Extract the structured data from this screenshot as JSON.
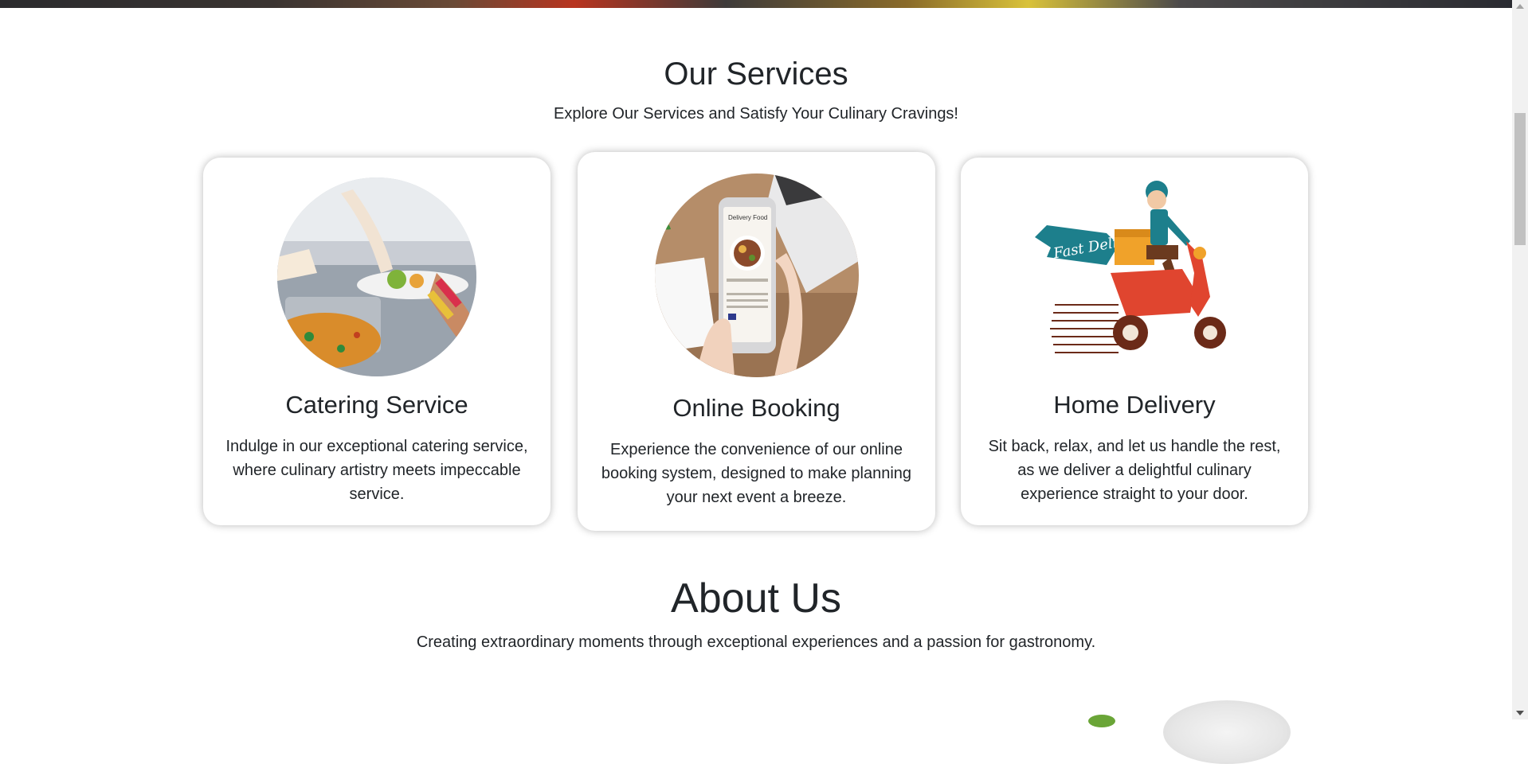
{
  "services": {
    "title": "Our Services",
    "subtitle": "Explore Our Services and Satisfy Your Culinary Cravings!",
    "cards": [
      {
        "title": "Catering Service",
        "text": "Indulge in our exceptional catering service, where culinary artistry meets impeccable service.",
        "image_icon": "catering-photo"
      },
      {
        "title": "Online Booking",
        "text": "Experience the convenience of our online booking system, designed to make planning your next event a breeze.",
        "image_icon": "phone-booking-photo"
      },
      {
        "title": "Home Delivery",
        "text": "Sit back, relax, and let us handle the rest, as we deliver a delightful culinary experience straight to your door.",
        "image_icon": "fast-delivery-scooter-illustration",
        "banner_text": "Fast Delivery"
      }
    ]
  },
  "about": {
    "title": "About Us",
    "subtitle": "Creating extraordinary moments through exceptional experiences and a passion for gastronomy."
  },
  "phone_screen": {
    "header": "Delivery Food"
  },
  "colors": {
    "text": "#212529",
    "card_bg": "#ffffff",
    "scooter_red": "#e0452f",
    "banner_teal": "#1d7f8c"
  }
}
